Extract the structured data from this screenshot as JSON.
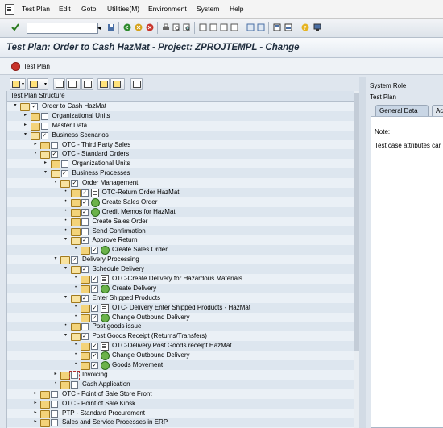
{
  "menu": [
    "Test Plan",
    "Edit",
    "Goto",
    "Utilities(M)",
    "Environment",
    "System",
    "Help"
  ],
  "title": "Test Plan: Order to Cash HazMat -  Project: ZPROJTEMPL - Change",
  "app_toolbar": {
    "test_plan_label": "Test Plan"
  },
  "tree_header": "Test Plan Structure",
  "tree_rows": [
    {
      "label": "Order to Cash HazMat",
      "level": 0,
      "exp": "open",
      "type": "folder",
      "checked": true
    },
    {
      "label": "Organizational Units",
      "level": 1,
      "exp": "closed",
      "type": "folder",
      "checked": false
    },
    {
      "label": "Master Data",
      "level": 1,
      "exp": "closed",
      "type": "folder",
      "checked": false
    },
    {
      "label": "Business Scenarios",
      "level": 1,
      "exp": "open",
      "type": "folder",
      "checked": true
    },
    {
      "label": "OTC - Third Party Sales",
      "level": 2,
      "exp": "closed",
      "type": "folder",
      "checked": false
    },
    {
      "label": "OTC - Standard Orders",
      "level": 2,
      "exp": "open",
      "type": "folder",
      "checked": true
    },
    {
      "label": "Organizational Units",
      "level": 3,
      "exp": "closed",
      "type": "folder",
      "checked": false
    },
    {
      "label": "Business Processes",
      "level": 3,
      "exp": "open",
      "type": "folder",
      "checked": true
    },
    {
      "label": "Order Management",
      "level": 4,
      "exp": "open",
      "type": "folder",
      "checked": true
    },
    {
      "label": "OTC-Return Order HazMat",
      "level": 5,
      "exp": "dot",
      "type": "folder",
      "checked": true,
      "icon": "doc"
    },
    {
      "label": "Create Sales Order",
      "level": 5,
      "exp": "dot",
      "type": "folder",
      "checked": true,
      "icon": "gear"
    },
    {
      "label": "Credit Memos for HazMat",
      "level": 5,
      "exp": "dot",
      "type": "folder",
      "checked": true,
      "icon": "gear"
    },
    {
      "label": "Create Sales Order",
      "level": 5,
      "exp": "dot",
      "type": "folder",
      "checked": false
    },
    {
      "label": "Send Confirmation",
      "level": 5,
      "exp": "dot",
      "type": "folder",
      "checked": false
    },
    {
      "label": "Approve Return",
      "level": 5,
      "exp": "open",
      "type": "folder",
      "checked": true
    },
    {
      "label": "Create Sales Order",
      "level": 6,
      "exp": "dot",
      "type": "folder",
      "checked": true,
      "icon": "gear"
    },
    {
      "label": "Delivery Processing",
      "level": 4,
      "exp": "open",
      "type": "folder",
      "checked": true
    },
    {
      "label": "Schedule Delivery",
      "level": 5,
      "exp": "open",
      "type": "folder",
      "checked": true
    },
    {
      "label": "OTC-Create Delivery for Hazardous Materials",
      "level": 6,
      "exp": "dot",
      "type": "folder",
      "checked": true,
      "icon": "doc"
    },
    {
      "label": "Create Delivery",
      "level": 6,
      "exp": "dot",
      "type": "folder",
      "checked": true,
      "icon": "gear"
    },
    {
      "label": "Enter Shipped Products",
      "level": 5,
      "exp": "open",
      "type": "folder",
      "checked": true
    },
    {
      "label": "OTC- Delivery Enter Shipped Products - HazMat",
      "level": 6,
      "exp": "dot",
      "type": "folder",
      "checked": true,
      "icon": "doc"
    },
    {
      "label": "Change Outbound Delivery",
      "level": 6,
      "exp": "dot",
      "type": "folder",
      "checked": true,
      "icon": "gear"
    },
    {
      "label": "Post goods issue",
      "level": 5,
      "exp": "dot",
      "type": "folder",
      "checked": false
    },
    {
      "label": "Post Goods Receipt (Returns/Transfers)",
      "level": 5,
      "exp": "open",
      "type": "folder",
      "checked": true
    },
    {
      "label": "OTC-Delivery Post Goods receipt HazMat",
      "level": 6,
      "exp": "dot",
      "type": "folder",
      "checked": true,
      "icon": "doc"
    },
    {
      "label": "Change Outbound Delivery",
      "level": 6,
      "exp": "dot",
      "type": "folder",
      "checked": true,
      "icon": "gear"
    },
    {
      "label": "Goods Movement",
      "level": 6,
      "exp": "dot",
      "type": "folder",
      "checked": true,
      "icon": "gear"
    },
    {
      "label": "Invoicing",
      "level": 4,
      "exp": "closed",
      "type": "folder",
      "checked": false,
      "selected": true
    },
    {
      "label": "Cash Application",
      "level": 4,
      "exp": "dot",
      "type": "folder",
      "checked": false
    },
    {
      "label": "OTC - Point of Sale Store Front",
      "level": 2,
      "exp": "closed",
      "type": "folder",
      "checked": false
    },
    {
      "label": "OTC - Point of Sale Kiosk",
      "level": 2,
      "exp": "closed",
      "type": "folder",
      "checked": false
    },
    {
      "label": "PTP - Standard Procurement",
      "level": 2,
      "exp": "closed",
      "type": "folder",
      "checked": false
    },
    {
      "label": "Sales and Service Processes in ERP",
      "level": 2,
      "exp": "closed",
      "type": "folder",
      "checked": false
    }
  ],
  "right_panel": {
    "system_role_label": "System Role",
    "test_plan_label": "Test Plan",
    "tabs": [
      "General Data",
      "Ac"
    ],
    "note_label": "Note:",
    "attributes_text": "Test case attributes car"
  }
}
